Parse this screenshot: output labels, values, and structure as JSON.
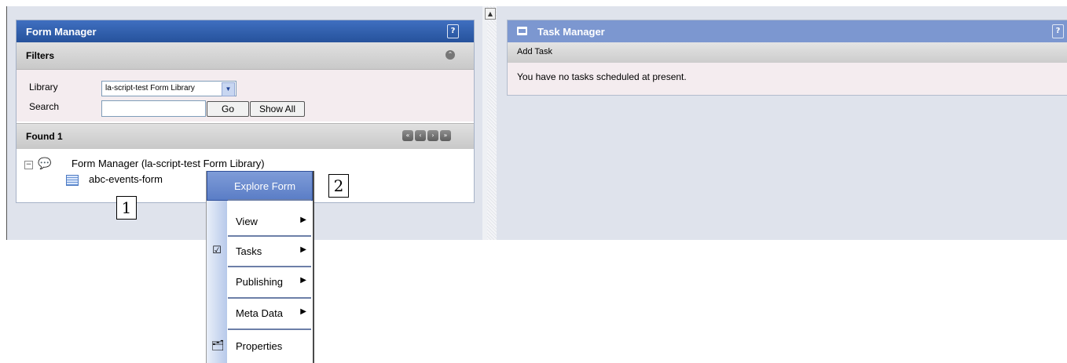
{
  "form_manager": {
    "title": "Form Manager",
    "filters_label": "Filters",
    "library_label": "Library",
    "library_value": "la-script-test Form Library",
    "search_label": "Search",
    "search_value": "",
    "go_label": "Go",
    "show_all_label": "Show All",
    "found_label": "Found 1",
    "tree_root": "Form Manager (la-script-test Form Library)",
    "tree_child": "abc-events-form"
  },
  "task_manager": {
    "title": "Task Manager",
    "add_task_label": "Add Task",
    "empty_message": "You have no tasks scheduled at present."
  },
  "context_menu": {
    "items": [
      "Explore Form",
      "View",
      "Tasks",
      "Publishing",
      "Meta Data",
      "Properties"
    ]
  },
  "callouts": [
    "1",
    "2"
  ],
  "colors": {
    "title_bar": "#26529c",
    "task_title_bar": "#7c97d0",
    "menu_highlight": "#5a7dc6"
  }
}
